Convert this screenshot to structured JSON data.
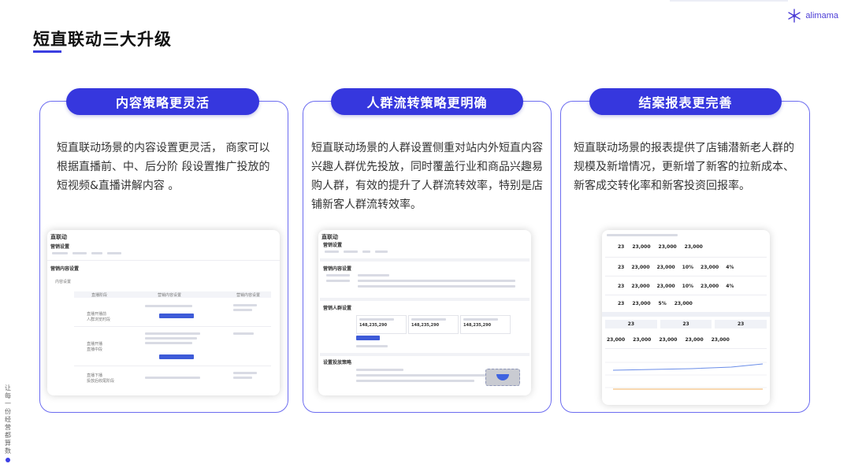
{
  "brand": {
    "logo_text": "alimama"
  },
  "page": {
    "title": "短直联动三大升级"
  },
  "sidebar": {
    "chars": [
      "让",
      "每",
      "一",
      "份",
      "经",
      "营",
      "都",
      "算",
      "数"
    ]
  },
  "cards": [
    {
      "heading": "内容策略更灵活",
      "body": "短直联动场景的内容设置更灵活， 商家可以根据直播前、中、后分阶 段设置推广投放的短视频&直播讲解内容 。",
      "screenshot": {
        "header": "直联动",
        "sections": [
          "营销设置",
          "营销内容设置",
          "内容设置"
        ],
        "columns": [
          "直播阶段",
          "营销内容设置",
          "营销内容设置"
        ],
        "rows": [
          "直播开播前\n人群浏览时段",
          "直播开播\n直播中段",
          "直播下播\n投放后收尾阶段"
        ]
      }
    },
    {
      "heading": "人群流转策略更明确",
      "body": "短直联动场景的人群设置侧重对站内外短直内容兴趣人群优先投放，同时覆盖行业和商品兴趣易购人群，有效的提升了人群流转效率，特别是店铺新客人群流转效率。",
      "screenshot": {
        "header": "直联动",
        "sections": [
          "营销设置",
          "营销内容设置",
          "营销人群设置",
          "设置投放策略"
        ],
        "stats": [
          "148,235,290",
          "148,235,290",
          "148,235,290"
        ]
      }
    },
    {
      "heading": "结案报表更完善",
      "body": "短直联动场景的报表提供了店铺潜新老人群的规模及新增情况，更新增了新客的拉新成本、新客成交转化率和新客投资回报率。",
      "screenshot": {
        "kpis": [
          [
            "23",
            "23,000",
            "23,000",
            "23,000"
          ],
          [
            "23",
            "23,000",
            "23,000",
            "10%",
            "23,000",
            "4%"
          ],
          [
            "23",
            "23,000",
            "23,000",
            "10%",
            "23,000",
            "4%"
          ],
          [
            "23",
            "23,000",
            "5%",
            "23,000"
          ]
        ],
        "tabs": [
          "23",
          "23",
          "23"
        ],
        "trend_values": [
          "23,000",
          "23,000",
          "23,000",
          "23,000",
          "23,000"
        ]
      }
    }
  ]
}
